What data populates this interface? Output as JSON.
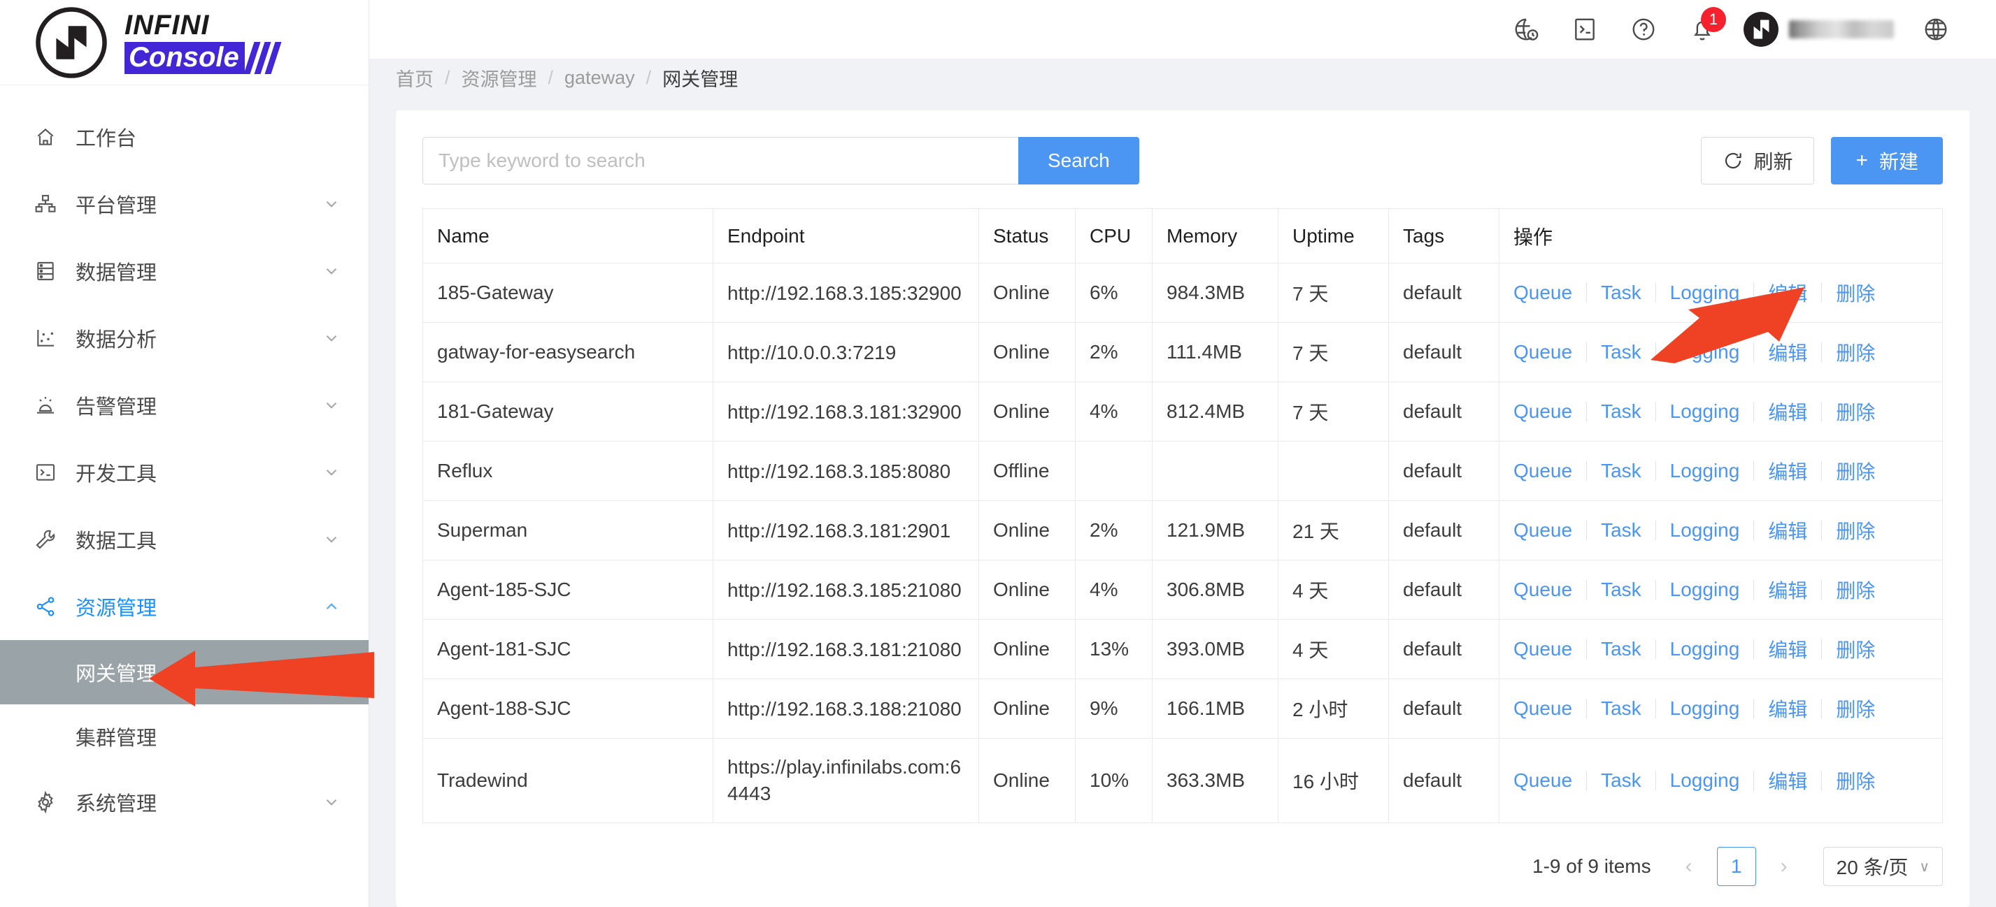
{
  "brand": {
    "name_top": "INFINI",
    "name_bottom": "Console",
    "accent_color": "#4326d6"
  },
  "sidebar": {
    "items": [
      {
        "label": "工作台",
        "icon": "home-icon",
        "expandable": false,
        "active": false
      },
      {
        "label": "平台管理",
        "icon": "cluster-icon",
        "expandable": true,
        "active": false
      },
      {
        "label": "数据管理",
        "icon": "database-icon",
        "expandable": true,
        "active": false
      },
      {
        "label": "数据分析",
        "icon": "chart-icon",
        "expandable": true,
        "active": false
      },
      {
        "label": "告警管理",
        "icon": "alert-icon",
        "expandable": true,
        "active": false
      },
      {
        "label": "开发工具",
        "icon": "console-icon",
        "expandable": true,
        "active": false
      },
      {
        "label": "数据工具",
        "icon": "wrench-icon",
        "expandable": true,
        "active": false
      },
      {
        "label": "资源管理",
        "icon": "share-icon",
        "expandable": true,
        "active": true
      }
    ],
    "sub_items": [
      {
        "label": "网关管理",
        "selected": true
      },
      {
        "label": "集群管理",
        "selected": false
      }
    ],
    "tail_items": [
      {
        "label": "系统管理",
        "icon": "gear-icon",
        "expandable": true
      }
    ]
  },
  "topbar": {
    "icons": [
      {
        "name": "timezone-icon",
        "title": "timezone"
      },
      {
        "name": "console-icon",
        "title": "console"
      },
      {
        "name": "help-icon",
        "title": "help"
      },
      {
        "name": "bell-icon",
        "title": "notifications"
      }
    ],
    "notification_count": "1",
    "notification_badge_color": "#f5222d",
    "language_icon": "globe-icon"
  },
  "breadcrumb": {
    "items": [
      "首页",
      "资源管理",
      "gateway",
      "网关管理"
    ],
    "separator": "/"
  },
  "toolbar": {
    "search_placeholder": "Type keyword to search",
    "search_value": "",
    "search_label": "Search",
    "refresh_label": "刷新",
    "create_label": "新建",
    "create_plus": "+",
    "primary_color": "#4b95f3"
  },
  "table": {
    "columns": [
      "Name",
      "Endpoint",
      "Status",
      "CPU",
      "Memory",
      "Uptime",
      "Tags",
      "操作"
    ],
    "actions": [
      "Queue",
      "Task",
      "Logging",
      "编辑",
      "删除"
    ],
    "status_online_color": "#2d9b35",
    "status_offline_color": "#e03131",
    "rows": [
      {
        "name": "185-Gateway",
        "endpoint": "http://192.168.3.185:32900",
        "status": "Online",
        "cpu": "6%",
        "memory": "984.3MB",
        "uptime": "7 天",
        "tags": "default"
      },
      {
        "name": "gatway-for-easysearch",
        "endpoint": "http://10.0.0.3:7219",
        "status": "Online",
        "cpu": "2%",
        "memory": "111.4MB",
        "uptime": "7 天",
        "tags": "default"
      },
      {
        "name": "181-Gateway",
        "endpoint": "http://192.168.3.181:32900",
        "status": "Online",
        "cpu": "4%",
        "memory": "812.4MB",
        "uptime": "7 天",
        "tags": "default"
      },
      {
        "name": "Reflux",
        "endpoint": "http://192.168.3.185:8080",
        "status": "Offline",
        "cpu": "",
        "memory": "",
        "uptime": "",
        "tags": "default"
      },
      {
        "name": "Superman",
        "endpoint": "http://192.168.3.181:2901",
        "status": "Online",
        "cpu": "2%",
        "memory": "121.9MB",
        "uptime": "21 天",
        "tags": "default"
      },
      {
        "name": "Agent-185-SJC",
        "endpoint": "http://192.168.3.185:21080",
        "status": "Online",
        "cpu": "4%",
        "memory": "306.8MB",
        "uptime": "4 天",
        "tags": "default"
      },
      {
        "name": "Agent-181-SJC",
        "endpoint": "http://192.168.3.181:21080",
        "status": "Online",
        "cpu": "13%",
        "memory": "393.0MB",
        "uptime": "4 天",
        "tags": "default"
      },
      {
        "name": "Agent-188-SJC",
        "endpoint": "http://192.168.3.188:21080",
        "status": "Online",
        "cpu": "9%",
        "memory": "166.1MB",
        "uptime": "2 小时",
        "tags": "default"
      },
      {
        "name": "Tradewind",
        "endpoint": "https://play.infinilabs.com:64443",
        "status": "Online",
        "cpu": "10%",
        "memory": "363.3MB",
        "uptime": "16 小时",
        "tags": "default"
      }
    ]
  },
  "pagination": {
    "summary": "1-9 of 9 items",
    "prev": "‹",
    "next": "›",
    "current_page": "1",
    "page_size": "20 条/页",
    "caret": "∨"
  },
  "annotations": {
    "arrow_color": "#ef4123",
    "arrow_sidebar_target": "网关管理",
    "arrow_logging_target": "Logging"
  }
}
